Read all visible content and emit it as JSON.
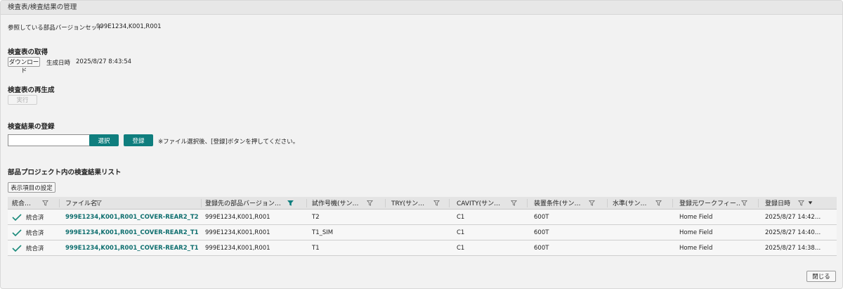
{
  "window": {
    "title": "検査表/検査結果の管理"
  },
  "reference": {
    "label": "参照している部品バージョンセット",
    "value": "999E1234,K001,R001"
  },
  "sheet_get": {
    "title": "検査表の取得",
    "download_label": "ダウンロード",
    "generated_label": "生成日時",
    "generated_value": "2025/8/27 8:43:54"
  },
  "regen": {
    "title": "検査表の再生成",
    "run_label": "実行"
  },
  "register": {
    "title": "検査結果の登録",
    "file_value": "",
    "select_label": "選択",
    "register_label": "登録",
    "note": "※ファイル選択後、[登録]ボタンを押してください。"
  },
  "list": {
    "title": "部品プロジェクト内の検査結果リスト",
    "display_settings_label": "表示項目の設定",
    "columns": [
      "統合…",
      "ファイル名",
      "登録先の部品バージョン…",
      "試作号機(サン…",
      "TRY(サン…",
      "CAVITY(サン…",
      "装置条件(サン…",
      "水準(サン…",
      "登録元ワークフィー…",
      "登録日時"
    ],
    "rows": [
      {
        "status": "統合済",
        "file": "999E1234,K001,R001_COVER-REAR2_T2…",
        "version": "999E1234,K001,R001",
        "proto": "T2",
        "try": "",
        "cavity": "C1",
        "equip": "600T",
        "level": "",
        "workfield": "Home Field",
        "date": "2025/8/27 14:42…"
      },
      {
        "status": "統合済",
        "file": "999E1234,K001,R001_COVER-REAR2_T1…",
        "version": "999E1234,K001,R001",
        "proto": "T1_SIM",
        "try": "",
        "cavity": "C1",
        "equip": "600T",
        "level": "",
        "workfield": "Home Field",
        "date": "2025/8/27 14:40…"
      },
      {
        "status": "統合済",
        "file": "999E1234,K001,R001_COVER-REAR2_T1…",
        "version": "999E1234,K001,R001",
        "proto": "T1",
        "try": "",
        "cavity": "C1",
        "equip": "600T",
        "level": "",
        "workfield": "Home Field",
        "date": "2025/8/27 14:38…"
      }
    ]
  },
  "footer": {
    "close_label": "閉じる"
  },
  "colors": {
    "accent": "#0f7e7e",
    "check": "#1a8a7a",
    "active_filter": "#0f7e7e"
  },
  "icons": {
    "filter": "filter-icon",
    "check": "check-icon",
    "sort": "sort-desc-icon"
  }
}
